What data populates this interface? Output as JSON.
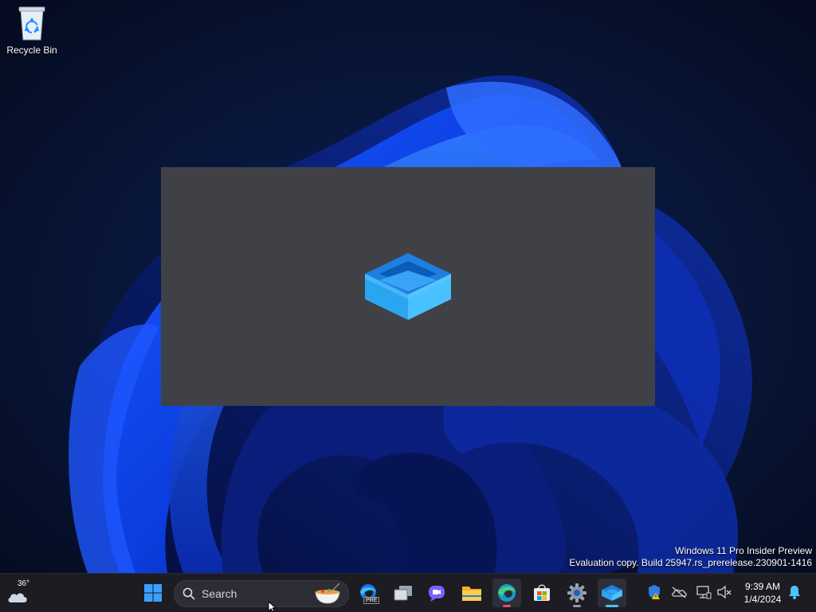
{
  "desktop": {
    "icons": [
      {
        "label": "Recycle Bin",
        "icon": "recycle-bin-icon"
      }
    ]
  },
  "splash": {
    "icon": "sandbox-cube-icon",
    "background": "#3f4146"
  },
  "watermark": {
    "line1": "Windows 11 Pro Insider Preview",
    "line2": "Evaluation copy. Build 25947.rs_prerelease.230901-1416"
  },
  "taskbar": {
    "weather": {
      "temp": "36°",
      "icon": "cloudy-weather-icon"
    },
    "search": {
      "placeholder": "Search"
    },
    "apps": [
      {
        "name": "start",
        "icon": "windows-start-icon"
      },
      {
        "name": "edge-preview",
        "icon": "edge-pre-icon",
        "badge": "PRE"
      },
      {
        "name": "task-view",
        "icon": "task-view-icon"
      },
      {
        "name": "teams",
        "icon": "teams-chat-icon"
      },
      {
        "name": "file-explorer",
        "icon": "folder-icon"
      },
      {
        "name": "edge",
        "icon": "edge-icon"
      },
      {
        "name": "store",
        "icon": "store-icon"
      },
      {
        "name": "settings",
        "icon": "gear-icon"
      },
      {
        "name": "windows-sandbox",
        "icon": "sandbox-cube-icon"
      }
    ],
    "tray": [
      {
        "name": "security",
        "icon": "shield-warning-icon"
      },
      {
        "name": "onedrive",
        "icon": "cloud-off-icon"
      },
      {
        "name": "network",
        "icon": "network-icon"
      },
      {
        "name": "volume",
        "icon": "volume-muted-icon"
      }
    ],
    "clock": {
      "time": "9:39 AM",
      "date": "1/4/2024"
    },
    "notifications": {
      "icon": "bell-icon"
    }
  },
  "colors": {
    "accent": "#0078d4",
    "taskbar": "#1c1c22",
    "splash": "#3f4146"
  }
}
